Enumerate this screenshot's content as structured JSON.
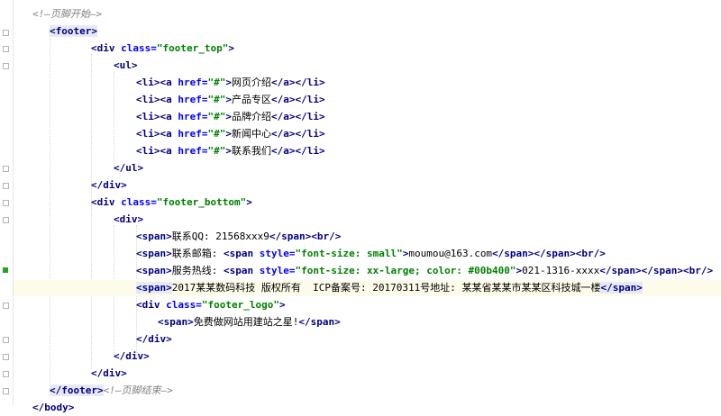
{
  "lines": [
    {
      "id": "l0",
      "segments": [
        {
          "t": "cmt",
          "v": "<!—页脚开始—>"
        }
      ]
    },
    {
      "id": "l1",
      "segments": [
        {
          "t": "tag hl",
          "v": "<footer>"
        }
      ]
    },
    {
      "id": "l2",
      "segments": [
        {
          "t": "tag",
          "v": "<div "
        },
        {
          "t": "attr",
          "v": "class="
        },
        {
          "t": "str",
          "v": "\"footer_top\""
        },
        {
          "t": "tag",
          "v": ">"
        }
      ]
    },
    {
      "id": "l3",
      "segments": [
        {
          "t": "tag",
          "v": "<ul>"
        }
      ]
    },
    {
      "id": "l4",
      "segments": [
        {
          "t": "tag",
          "v": "<li><a "
        },
        {
          "t": "attr",
          "v": "href="
        },
        {
          "t": "str",
          "v": "\"#\""
        },
        {
          "t": "tag",
          "v": ">"
        },
        {
          "t": "txt",
          "v": "网页介绍"
        },
        {
          "t": "tag",
          "v": "</a></li>"
        }
      ]
    },
    {
      "id": "l5",
      "segments": [
        {
          "t": "tag",
          "v": "<li><a "
        },
        {
          "t": "attr",
          "v": "href="
        },
        {
          "t": "str",
          "v": "\"#\""
        },
        {
          "t": "tag",
          "v": ">"
        },
        {
          "t": "txt",
          "v": "产品专区"
        },
        {
          "t": "tag",
          "v": "</a></li>"
        }
      ]
    },
    {
      "id": "l6",
      "segments": [
        {
          "t": "tag",
          "v": "<li><a "
        },
        {
          "t": "attr",
          "v": "href="
        },
        {
          "t": "str",
          "v": "\"#\""
        },
        {
          "t": "tag",
          "v": ">"
        },
        {
          "t": "txt",
          "v": "品牌介绍"
        },
        {
          "t": "tag",
          "v": "</a></li>"
        }
      ]
    },
    {
      "id": "l7",
      "segments": [
        {
          "t": "tag",
          "v": "<li><a "
        },
        {
          "t": "attr",
          "v": "href="
        },
        {
          "t": "str",
          "v": "\"#\""
        },
        {
          "t": "tag",
          "v": ">"
        },
        {
          "t": "txt",
          "v": "新闻中心"
        },
        {
          "t": "tag",
          "v": "</a></li>"
        }
      ]
    },
    {
      "id": "l8",
      "segments": [
        {
          "t": "tag",
          "v": "<li><a "
        },
        {
          "t": "attr",
          "v": "href="
        },
        {
          "t": "str",
          "v": "\"#\""
        },
        {
          "t": "tag",
          "v": ">"
        },
        {
          "t": "txt",
          "v": "联系我们"
        },
        {
          "t": "tag",
          "v": "</a></li>"
        }
      ]
    },
    {
      "id": "l9",
      "segments": [
        {
          "t": "tag",
          "v": "</ul>"
        }
      ]
    },
    {
      "id": "l10",
      "segments": [
        {
          "t": "tag",
          "v": "</div>"
        }
      ]
    },
    {
      "id": "l11",
      "segments": [
        {
          "t": "tag",
          "v": "<div "
        },
        {
          "t": "attr",
          "v": "class="
        },
        {
          "t": "str",
          "v": "\"footer_bottom\""
        },
        {
          "t": "tag",
          "v": ">"
        }
      ]
    },
    {
      "id": "l12",
      "segments": [
        {
          "t": "tag",
          "v": "<div>"
        }
      ]
    },
    {
      "id": "l13",
      "segments": [
        {
          "t": "tag",
          "v": "<span>"
        },
        {
          "t": "txt",
          "v": "联系QQ: 21568xxx9"
        },
        {
          "t": "tag",
          "v": "</span><br/>"
        }
      ]
    },
    {
      "id": "l14",
      "segments": [
        {
          "t": "tag",
          "v": "<span>"
        },
        {
          "t": "txt",
          "v": "联系邮箱: "
        },
        {
          "t": "tag",
          "v": "<span "
        },
        {
          "t": "attr",
          "v": "style="
        },
        {
          "t": "str",
          "v": "\"font-size: small\""
        },
        {
          "t": "tag",
          "v": ">"
        },
        {
          "t": "txt",
          "v": "moumou@163.com"
        },
        {
          "t": "tag",
          "v": "</span></span><br/>"
        }
      ]
    },
    {
      "id": "l15",
      "segments": [
        {
          "t": "tag",
          "v": "<span>"
        },
        {
          "t": "txt",
          "v": "服务热线: "
        },
        {
          "t": "tag",
          "v": "<span "
        },
        {
          "t": "attr",
          "v": "style="
        },
        {
          "t": "str",
          "v": "\"font-size: xx-large; color: #00b400\""
        },
        {
          "t": "tag",
          "v": ">"
        },
        {
          "t": "txt",
          "v": "021-1316-xxxx"
        },
        {
          "t": "tag",
          "v": "</span></span><br/>"
        }
      ]
    },
    {
      "id": "l16",
      "segments": [
        {
          "t": "tag hl",
          "v": "<span>"
        },
        {
          "t": "txt",
          "v": "2017某某数码科技 版权所有  ICP备案号: 20170311号地址: 某某省某某市某某区科技城一楼"
        },
        {
          "t": "tag hl",
          "v": "</span>"
        }
      ]
    },
    {
      "id": "l17",
      "segments": [
        {
          "t": "tag",
          "v": "<div "
        },
        {
          "t": "attr",
          "v": "class="
        },
        {
          "t": "str",
          "v": "\"footer_logo\""
        },
        {
          "t": "tag",
          "v": ">"
        }
      ]
    },
    {
      "id": "l18",
      "segments": [
        {
          "t": "tag",
          "v": "<span>"
        },
        {
          "t": "txt",
          "v": "免费做网站用建站之星!"
        },
        {
          "t": "tag",
          "v": "</span>"
        }
      ]
    },
    {
      "id": "l19",
      "segments": [
        {
          "t": "tag",
          "v": "</div>"
        }
      ]
    },
    {
      "id": "l20",
      "segments": [
        {
          "t": "tag",
          "v": "</div>"
        }
      ]
    },
    {
      "id": "l21",
      "segments": [
        {
          "t": "tag",
          "v": "</div>"
        }
      ]
    },
    {
      "id": "l22",
      "segments": [
        {
          "t": "tag hl",
          "v": "</footer>"
        },
        {
          "t": "cmt",
          "v": "<!—页脚结束—>"
        }
      ]
    },
    {
      "id": "l23",
      "segments": [
        {
          "t": "tag",
          "v": "</body>"
        }
      ]
    }
  ]
}
